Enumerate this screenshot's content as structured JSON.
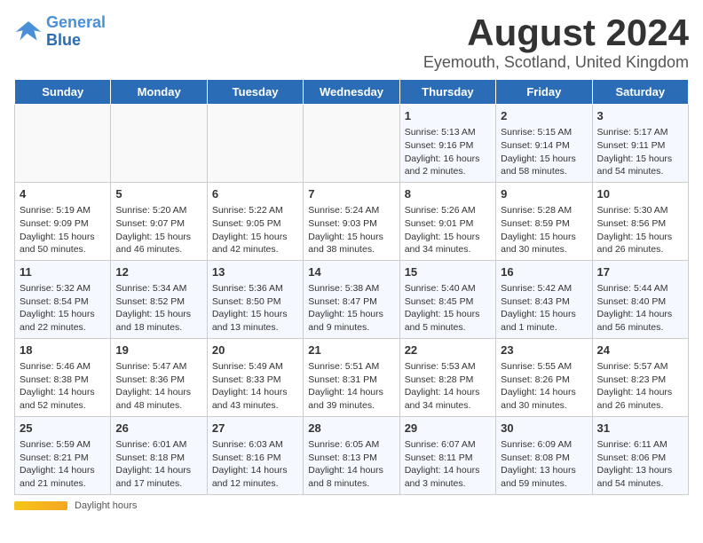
{
  "logo": {
    "line1": "General",
    "line2": "Blue"
  },
  "title": "August 2024",
  "subtitle": "Eyemouth, Scotland, United Kingdom",
  "days_of_week": [
    "Sunday",
    "Monday",
    "Tuesday",
    "Wednesday",
    "Thursday",
    "Friday",
    "Saturday"
  ],
  "footer": {
    "daylight_label": "Daylight hours"
  },
  "weeks": [
    [
      {
        "day": "",
        "info": ""
      },
      {
        "day": "",
        "info": ""
      },
      {
        "day": "",
        "info": ""
      },
      {
        "day": "",
        "info": ""
      },
      {
        "day": "1",
        "info": "Sunrise: 5:13 AM\nSunset: 9:16 PM\nDaylight: 16 hours and 2 minutes."
      },
      {
        "day": "2",
        "info": "Sunrise: 5:15 AM\nSunset: 9:14 PM\nDaylight: 15 hours and 58 minutes."
      },
      {
        "day": "3",
        "info": "Sunrise: 5:17 AM\nSunset: 9:11 PM\nDaylight: 15 hours and 54 minutes."
      }
    ],
    [
      {
        "day": "4",
        "info": "Sunrise: 5:19 AM\nSunset: 9:09 PM\nDaylight: 15 hours and 50 minutes."
      },
      {
        "day": "5",
        "info": "Sunrise: 5:20 AM\nSunset: 9:07 PM\nDaylight: 15 hours and 46 minutes."
      },
      {
        "day": "6",
        "info": "Sunrise: 5:22 AM\nSunset: 9:05 PM\nDaylight: 15 hours and 42 minutes."
      },
      {
        "day": "7",
        "info": "Sunrise: 5:24 AM\nSunset: 9:03 PM\nDaylight: 15 hours and 38 minutes."
      },
      {
        "day": "8",
        "info": "Sunrise: 5:26 AM\nSunset: 9:01 PM\nDaylight: 15 hours and 34 minutes."
      },
      {
        "day": "9",
        "info": "Sunrise: 5:28 AM\nSunset: 8:59 PM\nDaylight: 15 hours and 30 minutes."
      },
      {
        "day": "10",
        "info": "Sunrise: 5:30 AM\nSunset: 8:56 PM\nDaylight: 15 hours and 26 minutes."
      }
    ],
    [
      {
        "day": "11",
        "info": "Sunrise: 5:32 AM\nSunset: 8:54 PM\nDaylight: 15 hours and 22 minutes."
      },
      {
        "day": "12",
        "info": "Sunrise: 5:34 AM\nSunset: 8:52 PM\nDaylight: 15 hours and 18 minutes."
      },
      {
        "day": "13",
        "info": "Sunrise: 5:36 AM\nSunset: 8:50 PM\nDaylight: 15 hours and 13 minutes."
      },
      {
        "day": "14",
        "info": "Sunrise: 5:38 AM\nSunset: 8:47 PM\nDaylight: 15 hours and 9 minutes."
      },
      {
        "day": "15",
        "info": "Sunrise: 5:40 AM\nSunset: 8:45 PM\nDaylight: 15 hours and 5 minutes."
      },
      {
        "day": "16",
        "info": "Sunrise: 5:42 AM\nSunset: 8:43 PM\nDaylight: 15 hours and 1 minute."
      },
      {
        "day": "17",
        "info": "Sunrise: 5:44 AM\nSunset: 8:40 PM\nDaylight: 14 hours and 56 minutes."
      }
    ],
    [
      {
        "day": "18",
        "info": "Sunrise: 5:46 AM\nSunset: 8:38 PM\nDaylight: 14 hours and 52 minutes."
      },
      {
        "day": "19",
        "info": "Sunrise: 5:47 AM\nSunset: 8:36 PM\nDaylight: 14 hours and 48 minutes."
      },
      {
        "day": "20",
        "info": "Sunrise: 5:49 AM\nSunset: 8:33 PM\nDaylight: 14 hours and 43 minutes."
      },
      {
        "day": "21",
        "info": "Sunrise: 5:51 AM\nSunset: 8:31 PM\nDaylight: 14 hours and 39 minutes."
      },
      {
        "day": "22",
        "info": "Sunrise: 5:53 AM\nSunset: 8:28 PM\nDaylight: 14 hours and 34 minutes."
      },
      {
        "day": "23",
        "info": "Sunrise: 5:55 AM\nSunset: 8:26 PM\nDaylight: 14 hours and 30 minutes."
      },
      {
        "day": "24",
        "info": "Sunrise: 5:57 AM\nSunset: 8:23 PM\nDaylight: 14 hours and 26 minutes."
      }
    ],
    [
      {
        "day": "25",
        "info": "Sunrise: 5:59 AM\nSunset: 8:21 PM\nDaylight: 14 hours and 21 minutes."
      },
      {
        "day": "26",
        "info": "Sunrise: 6:01 AM\nSunset: 8:18 PM\nDaylight: 14 hours and 17 minutes."
      },
      {
        "day": "27",
        "info": "Sunrise: 6:03 AM\nSunset: 8:16 PM\nDaylight: 14 hours and 12 minutes."
      },
      {
        "day": "28",
        "info": "Sunrise: 6:05 AM\nSunset: 8:13 PM\nDaylight: 14 hours and 8 minutes."
      },
      {
        "day": "29",
        "info": "Sunrise: 6:07 AM\nSunset: 8:11 PM\nDaylight: 14 hours and 3 minutes."
      },
      {
        "day": "30",
        "info": "Sunrise: 6:09 AM\nSunset: 8:08 PM\nDaylight: 13 hours and 59 minutes."
      },
      {
        "day": "31",
        "info": "Sunrise: 6:11 AM\nSunset: 8:06 PM\nDaylight: 13 hours and 54 minutes."
      }
    ]
  ]
}
